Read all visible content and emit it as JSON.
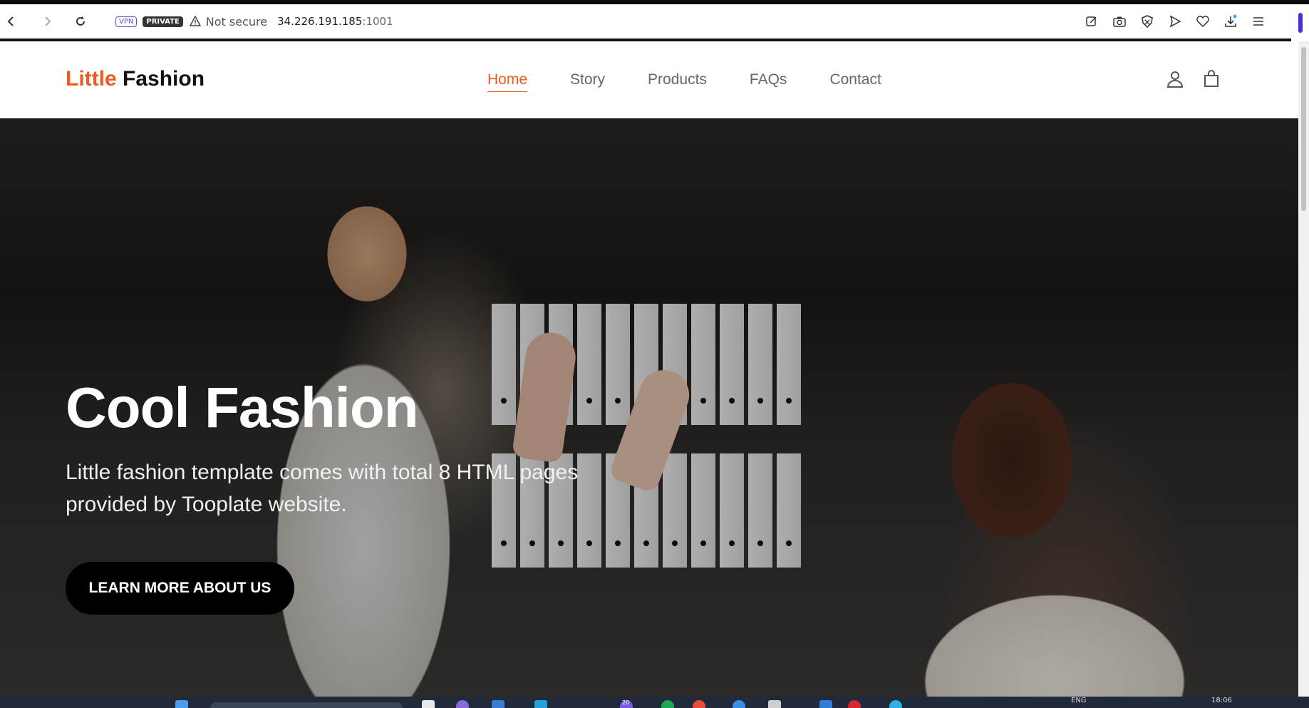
{
  "browser": {
    "vpn_badge": "VPN",
    "private_badge": "PRIVATE",
    "security_text": "Not secure",
    "url_host": "34.226.191.185",
    "url_port": ":1001",
    "icons": [
      "edit-icon",
      "camera-icon",
      "shield-icon",
      "send-icon",
      "heart-icon",
      "download-icon",
      "menu-icon"
    ]
  },
  "site": {
    "logo_accent": "Little",
    "logo_rest": "Fashion",
    "nav": [
      {
        "label": "Home",
        "active": true
      },
      {
        "label": "Story"
      },
      {
        "label": "Products"
      },
      {
        "label": "FAQs"
      },
      {
        "label": "Contact"
      }
    ],
    "icons": [
      "user-icon",
      "bag-icon"
    ]
  },
  "hero": {
    "title": "Cool Fashion",
    "subtitle": "Little fashion template comes with total 8 HTML pages provided by Tooplate website.",
    "button": "LEARN MORE ABOUT US"
  },
  "taskbar": {
    "badge_count": "20",
    "lang": "ENG",
    "time": "18:06"
  },
  "colors": {
    "accent": "#f15a22",
    "button_bg": "#000000"
  }
}
